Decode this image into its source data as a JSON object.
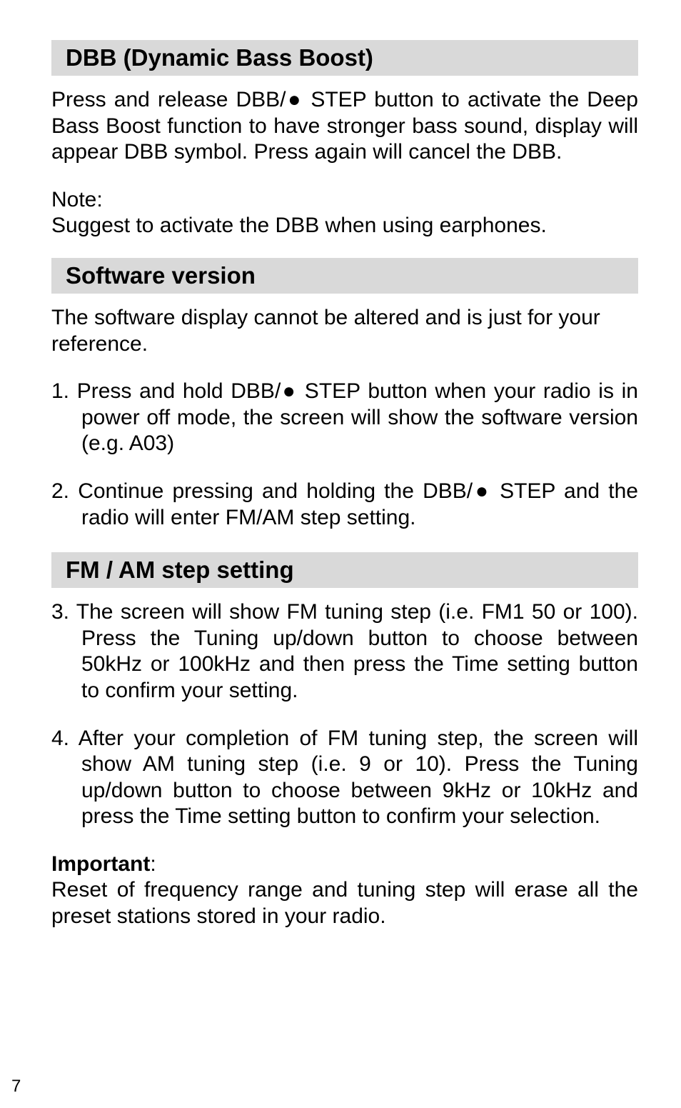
{
  "headings": {
    "h1": "DBB (Dynamic Bass Boost)",
    "h2": "Software version",
    "h3": "FM / AM step setting"
  },
  "paras": {
    "p1": "Press and release DBB/● STEP button to activate the Deep Bass Boost function to have stronger bass sound, display will appear DBB symbol. Press again will cancel the DBB.",
    "noteLabel": "Note:",
    "noteText": "Suggest to activate the DBB when using earphones.",
    "p2": "The software display cannot be altered and is just for your reference.",
    "li1": "1. Press and hold DBB/● STEP button when your radio is in power off mode, the screen will show the software version (e.g. A03)",
    "li2": "2. Continue pressing and holding the DBB/● STEP and the radio will enter FM/AM step setting.",
    "li3": "3. The screen will show FM tuning step (i.e. FM1 50 or 100). Press the Tuning up/down button to choose between 50kHz or 100kHz and then press the Time setting button to confirm your setting.",
    "li4": "4. After your completion of FM tuning step, the screen will show AM tuning step (i.e. 9  or 10). Press the Tuning up/down button to choose between 9kHz or 10kHz and press the Time setting button to confirm your selection.",
    "importantLabel": "Important",
    "importantColon": ":",
    "importantText": "Reset of frequency range and tuning step will erase all the preset stations stored in your radio."
  },
  "pageNumber": "7"
}
